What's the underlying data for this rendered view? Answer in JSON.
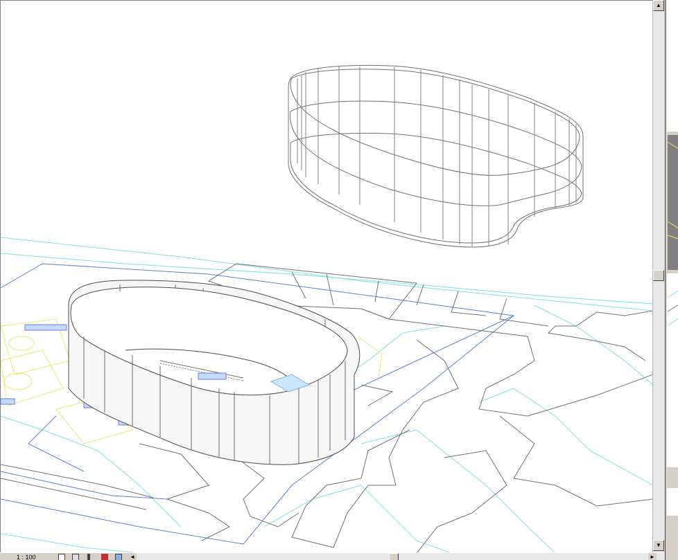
{
  "status": {
    "scale": "1 : 100"
  },
  "icons": {
    "scroll_up": "▲",
    "scroll_down": "▼",
    "scroll_left": "◄",
    "scroll_right": "►"
  },
  "colors": {
    "canvas": "#ffffff",
    "model_lines": "#5a5a5a",
    "site_blue": "#5b7fd9",
    "site_cyan": "#7fe0e0",
    "site_yellow": "#e8e870",
    "chrome": "#d4d0c8"
  }
}
